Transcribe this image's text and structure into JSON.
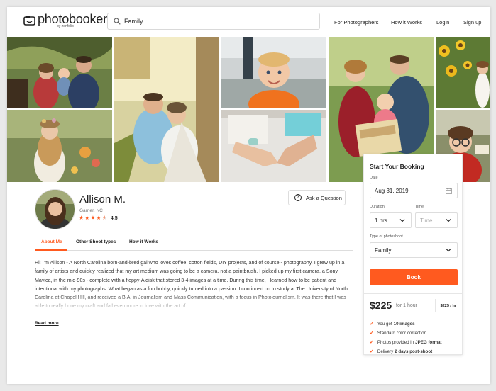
{
  "header": {
    "logo_text": "photobooker",
    "logo_sub": "by zenfolio",
    "search_value": "Family",
    "nav": [
      "For Photographers",
      "How it Works",
      "Login",
      "Sign up"
    ]
  },
  "profile": {
    "name": "Allison M.",
    "location": "Garner, NC",
    "rating": "4.5",
    "stars": 4.5,
    "ask_label": "Ask a Question"
  },
  "tabs": [
    "About Me",
    "Other Shoot types",
    "How it Works"
  ],
  "bio": "Hi! I'm Allison - A North Carolina born-and-bred gal who loves coffee, cotton fields, DIY projects, and of course - photography. I grew up in a family of artists and quickly realized that my art medium was going to be a camera, not a paintbrush. I picked up my first camera, a Sony Mavica, in the mid-90s - complete with a floppy-A disk that stored 3-4 images at a time. During this time, I learned how to be patient and intentional with my photographs. What began as a fun hobby, quickly turned into a passion. I continued on to study at The University of North Carolina at Chapel Hill, and received a B.A. in Journalism and Mass Communication, with a focus in Photojournalism. It was there that I was able to really hone my craft and fall even more in love with the art of",
  "read_more": "Read more",
  "booking": {
    "title": "Start Your Booking",
    "date_label": "Date",
    "date_value": "Aug 31, 2019",
    "duration_label": "Duration",
    "duration_value": "1 hrs",
    "time_label": "Time",
    "time_placeholder": "Time",
    "shoot_label": "Type of photoshoot",
    "shoot_value": "Family",
    "book_label": "Book",
    "price": "$225",
    "per": "for 1 hour",
    "price_side": "$225 / hr",
    "features": [
      {
        "text": "You get ",
        "bold": "10 images"
      },
      {
        "text": "Standard color correction",
        "bold": ""
      },
      {
        "text": "Photos provided in ",
        "bold": "JPEG format"
      },
      {
        "text": "Delivery ",
        "bold": "2 days post-shoot"
      }
    ]
  },
  "colors": {
    "accent": "#ff5a1f",
    "text": "#222222"
  }
}
